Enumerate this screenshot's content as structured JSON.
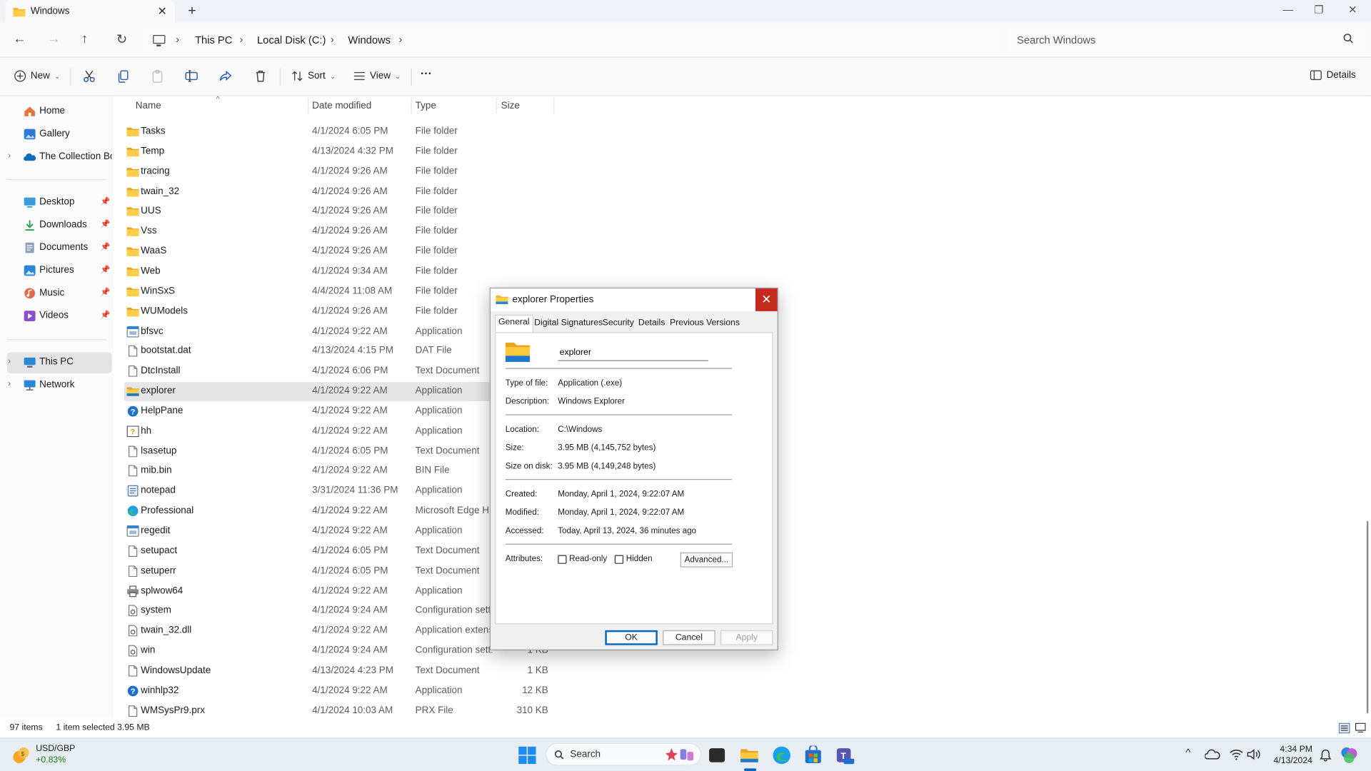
{
  "window": {
    "tab_title": "Windows",
    "new_tab": "+",
    "close_tab": "✕",
    "controls": {
      "minimize": "—",
      "maximize": "❐",
      "close": "✕"
    }
  },
  "addressbar": {
    "crumbs": [
      "This PC",
      "Local Disk (C:)",
      "Windows"
    ],
    "search_placeholder": "Search Windows"
  },
  "toolbar": {
    "new_label": "New",
    "sort_label": "Sort",
    "view_label": "View",
    "more_label": "···",
    "details_label": "Details"
  },
  "navpane": {
    "items": [
      {
        "label": "Home",
        "icon": "home-icon",
        "color": "#e8743b"
      },
      {
        "label": "Gallery",
        "icon": "gallery-icon",
        "color": "#2f7ad8"
      },
      {
        "label": "The Collection Book",
        "icon": "onedrive-icon",
        "color": "#0f6cbd"
      },
      {
        "label": "Desktop",
        "icon": "desktop-icon",
        "color": "#3a9bdc",
        "pinned": true
      },
      {
        "label": "Downloads",
        "icon": "downloads-icon",
        "color": "#2e9e5b",
        "pinned": true
      },
      {
        "label": "Documents",
        "icon": "documents-icon",
        "color": "#7a8a9a",
        "pinned": true
      },
      {
        "label": "Pictures",
        "icon": "pictures-icon",
        "color": "#2a86d6",
        "pinned": true
      },
      {
        "label": "Music",
        "icon": "music-icon",
        "color": "#e06a4b",
        "pinned": true
      },
      {
        "label": "Videos",
        "icon": "videos-icon",
        "color": "#8a4fcf",
        "pinned": true
      },
      {
        "label": "This PC",
        "icon": "this-pc-icon",
        "color": "#2a86d6"
      },
      {
        "label": "Network",
        "icon": "network-icon",
        "color": "#2a86d6"
      }
    ],
    "pin_glyph": "📌"
  },
  "columns": {
    "name": "Name",
    "date": "Date modified",
    "type": "Type",
    "size": "Size"
  },
  "files": [
    {
      "name": "Tasks",
      "date": "4/1/2024 6:05 PM",
      "type": "File folder",
      "size": "",
      "kind": "folder"
    },
    {
      "name": "Temp",
      "date": "4/13/2024 4:32 PM",
      "type": "File folder",
      "size": "",
      "kind": "folder"
    },
    {
      "name": "tracing",
      "date": "4/1/2024 9:26 AM",
      "type": "File folder",
      "size": "",
      "kind": "folder"
    },
    {
      "name": "twain_32",
      "date": "4/1/2024 9:26 AM",
      "type": "File folder",
      "size": "",
      "kind": "folder"
    },
    {
      "name": "UUS",
      "date": "4/1/2024 9:26 AM",
      "type": "File folder",
      "size": "",
      "kind": "folder"
    },
    {
      "name": "Vss",
      "date": "4/1/2024 9:26 AM",
      "type": "File folder",
      "size": "",
      "kind": "folder"
    },
    {
      "name": "WaaS",
      "date": "4/1/2024 9:26 AM",
      "type": "File folder",
      "size": "",
      "kind": "folder"
    },
    {
      "name": "Web",
      "date": "4/1/2024 9:34 AM",
      "type": "File folder",
      "size": "",
      "kind": "folder"
    },
    {
      "name": "WinSxS",
      "date": "4/4/2024 11:08 AM",
      "type": "File folder",
      "size": "",
      "kind": "folder"
    },
    {
      "name": "WUModels",
      "date": "4/1/2024 9:26 AM",
      "type": "File folder",
      "size": "",
      "kind": "folder"
    },
    {
      "name": "bfsvc",
      "date": "4/1/2024 9:22 AM",
      "type": "Application",
      "size": "",
      "kind": "app"
    },
    {
      "name": "bootstat.dat",
      "date": "4/13/2024 4:15 PM",
      "type": "DAT File",
      "size": "",
      "kind": "doc"
    },
    {
      "name": "DtcInstall",
      "date": "4/1/2024 6:06 PM",
      "type": "Text Document",
      "size": "",
      "kind": "doc"
    },
    {
      "name": "explorer",
      "date": "4/1/2024 9:22 AM",
      "type": "Application",
      "size": "",
      "kind": "explorer",
      "selected": true
    },
    {
      "name": "HelpPane",
      "date": "4/1/2024 9:22 AM",
      "type": "Application",
      "size": "",
      "kind": "help"
    },
    {
      "name": "hh",
      "date": "4/1/2024 9:22 AM",
      "type": "Application",
      "size": "",
      "kind": "help2"
    },
    {
      "name": "lsasetup",
      "date": "4/1/2024 6:05 PM",
      "type": "Text Document",
      "size": "",
      "kind": "doc"
    },
    {
      "name": "mib.bin",
      "date": "4/1/2024 9:22 AM",
      "type": "BIN File",
      "size": "",
      "kind": "doc"
    },
    {
      "name": "notepad",
      "date": "3/31/2024 11:36 PM",
      "type": "Application",
      "size": "",
      "kind": "notepad"
    },
    {
      "name": "Professional",
      "date": "4/1/2024 9:22 AM",
      "type": "Microsoft Edge H...",
      "size": "",
      "kind": "edge"
    },
    {
      "name": "regedit",
      "date": "4/1/2024 9:22 AM",
      "type": "Application",
      "size": "",
      "kind": "app"
    },
    {
      "name": "setupact",
      "date": "4/1/2024 6:05 PM",
      "type": "Text Document",
      "size": "",
      "kind": "doc"
    },
    {
      "name": "setuperr",
      "date": "4/1/2024 6:05 PM",
      "type": "Text Document",
      "size": "",
      "kind": "doc"
    },
    {
      "name": "splwow64",
      "date": "4/1/2024 9:22 AM",
      "type": "Application",
      "size": "",
      "kind": "printer"
    },
    {
      "name": "system",
      "date": "4/1/2024 9:24 AM",
      "type": "Configuration sett...",
      "size": "",
      "kind": "config"
    },
    {
      "name": "twain_32.dll",
      "date": "4/1/2024 9:22 AM",
      "type": "Application extens...",
      "size": "",
      "kind": "config"
    },
    {
      "name": "win",
      "date": "4/1/2024 9:24 AM",
      "type": "Configuration sett...",
      "size": "1 KB",
      "kind": "config"
    },
    {
      "name": "WindowsUpdate",
      "date": "4/13/2024 4:23 PM",
      "type": "Text Document",
      "size": "1 KB",
      "kind": "doc"
    },
    {
      "name": "winhlp32",
      "date": "4/1/2024 9:22 AM",
      "type": "Application",
      "size": "12 KB",
      "kind": "help"
    },
    {
      "name": "WMSysPr9.prx",
      "date": "4/1/2024 10:03 AM",
      "type": "PRX File",
      "size": "310 KB",
      "kind": "doc"
    }
  ],
  "status": {
    "items": "97 items",
    "selected": "1 item selected  3.95 MB"
  },
  "dialog": {
    "title": "explorer Properties",
    "tabs": [
      "General",
      "Digital Signatures",
      "Security",
      "Details",
      "Previous Versions"
    ],
    "name_value": "explorer",
    "type_label": "Type of file:",
    "type_value": "Application (.exe)",
    "desc_label": "Description:",
    "desc_value": "Windows Explorer",
    "location_label": "Location:",
    "location_value": "C:\\Windows",
    "size_label": "Size:",
    "size_value": "3.95 MB (4,145,752 bytes)",
    "sizedisk_label": "Size on disk:",
    "sizedisk_value": "3.95 MB (4,149,248 bytes)",
    "created_label": "Created:",
    "created_value": "Monday, April 1, 2024, 9:22:07 AM",
    "modified_label": "Modified:",
    "modified_value": "Monday, April 1, 2024, 9:22:07 AM",
    "accessed_label": "Accessed:",
    "accessed_value": "Today, April 13, 2024, 36 minutes ago",
    "attributes_label": "Attributes:",
    "readonly_label": "Read-only",
    "hidden_label": "Hidden",
    "advanced_label": "Advanced...",
    "ok_label": "OK",
    "cancel_label": "Cancel",
    "apply_label": "Apply"
  },
  "taskbar": {
    "widget_label": "USD/GBP",
    "widget_value": "+0.83%",
    "search_placeholder": "Search",
    "time": "4:34 PM",
    "date": "4/13/2024"
  }
}
